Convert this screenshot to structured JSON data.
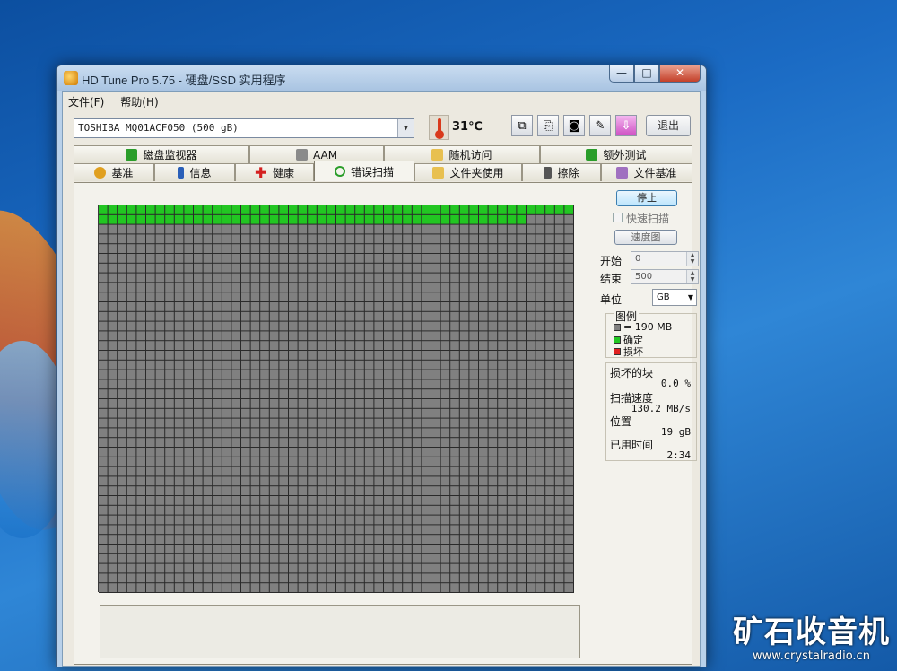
{
  "window": {
    "title": "HD Tune Pro 5.75 - 硬盘/SSD 实用程序"
  },
  "caption_buttons": {
    "minimize": "—",
    "maximize": "□",
    "close": "✕"
  },
  "menu": {
    "items": [
      "文件(F)",
      "帮助(H)"
    ]
  },
  "toolbar": {
    "drive": "TOSHIBA MQ01ACF050 (500 gB)",
    "temperature": "31℃",
    "exit_label": "退出",
    "icons": [
      "copy-icon",
      "copy-all-icon",
      "screenshot-icon",
      "options-icon",
      "save-icon"
    ]
  },
  "tabs": {
    "top": [
      {
        "label": "磁盘监视器",
        "icon": "monitor-icon",
        "color": "#2a9d2a"
      },
      {
        "label": "AAM",
        "icon": "speaker-icon",
        "color": "#8a8a8a"
      },
      {
        "label": "随机访问",
        "icon": "random-access-icon",
        "color": "#e8c050"
      },
      {
        "label": "额外测试",
        "icon": "extra-tests-icon",
        "color": "#2a9d2a"
      }
    ],
    "bottom": [
      {
        "label": "基准",
        "icon": "benchmark-icon",
        "color": "#e0a020"
      },
      {
        "label": "信息",
        "icon": "info-icon",
        "color": "#2a5fb8"
      },
      {
        "label": "健康",
        "icon": "health-icon",
        "color": "#d42020"
      },
      {
        "label": "错误扫描",
        "icon": "error-scan-icon",
        "color": "#2a9d2a",
        "active": true
      },
      {
        "label": "文件夹使用",
        "icon": "folder-icon",
        "color": "#e8c050"
      },
      {
        "label": "擦除",
        "icon": "erase-icon",
        "color": "#555555"
      },
      {
        "label": "文件基准",
        "icon": "file-benchmark-icon",
        "color": "#a070c0"
      }
    ]
  },
  "scan": {
    "stop_label": "停止",
    "quick_scan_label": "快速扫描",
    "quick_scan_checked": false,
    "speed_map_label": "速度图",
    "start_label": "开始",
    "start_value": "0",
    "end_label": "结束",
    "end_value": "500",
    "unit_label": "单位",
    "unit_value": "GB",
    "legend": {
      "title": "图例",
      "items": [
        {
          "label": "= 190 MB",
          "color": "#808080"
        },
        {
          "label": "确定",
          "color": "#22c622"
        },
        {
          "label": "损坏",
          "color": "#e02020"
        }
      ]
    },
    "stats": {
      "damaged_blocks_label": "损坏的块",
      "damaged_blocks_value": "0.0 %",
      "scan_speed_label": "扫描速度",
      "scan_speed_value": "130.2 MB/s",
      "position_label": "位置",
      "position_value": "19 gB",
      "elapsed_label": "已用时间",
      "elapsed_value": "2:34"
    },
    "grid": {
      "columns": 50,
      "rows": 40,
      "scanned_blocks": 95,
      "ok_color": "#22c622",
      "pending_color": "#808080",
      "line_color": "#2a2a2a"
    }
  },
  "watermark": {
    "title": "矿石收音机",
    "url": "www.crystalradio.cn"
  },
  "colors": {
    "accent": "#22c622",
    "desktop": "#1b6bc4"
  }
}
